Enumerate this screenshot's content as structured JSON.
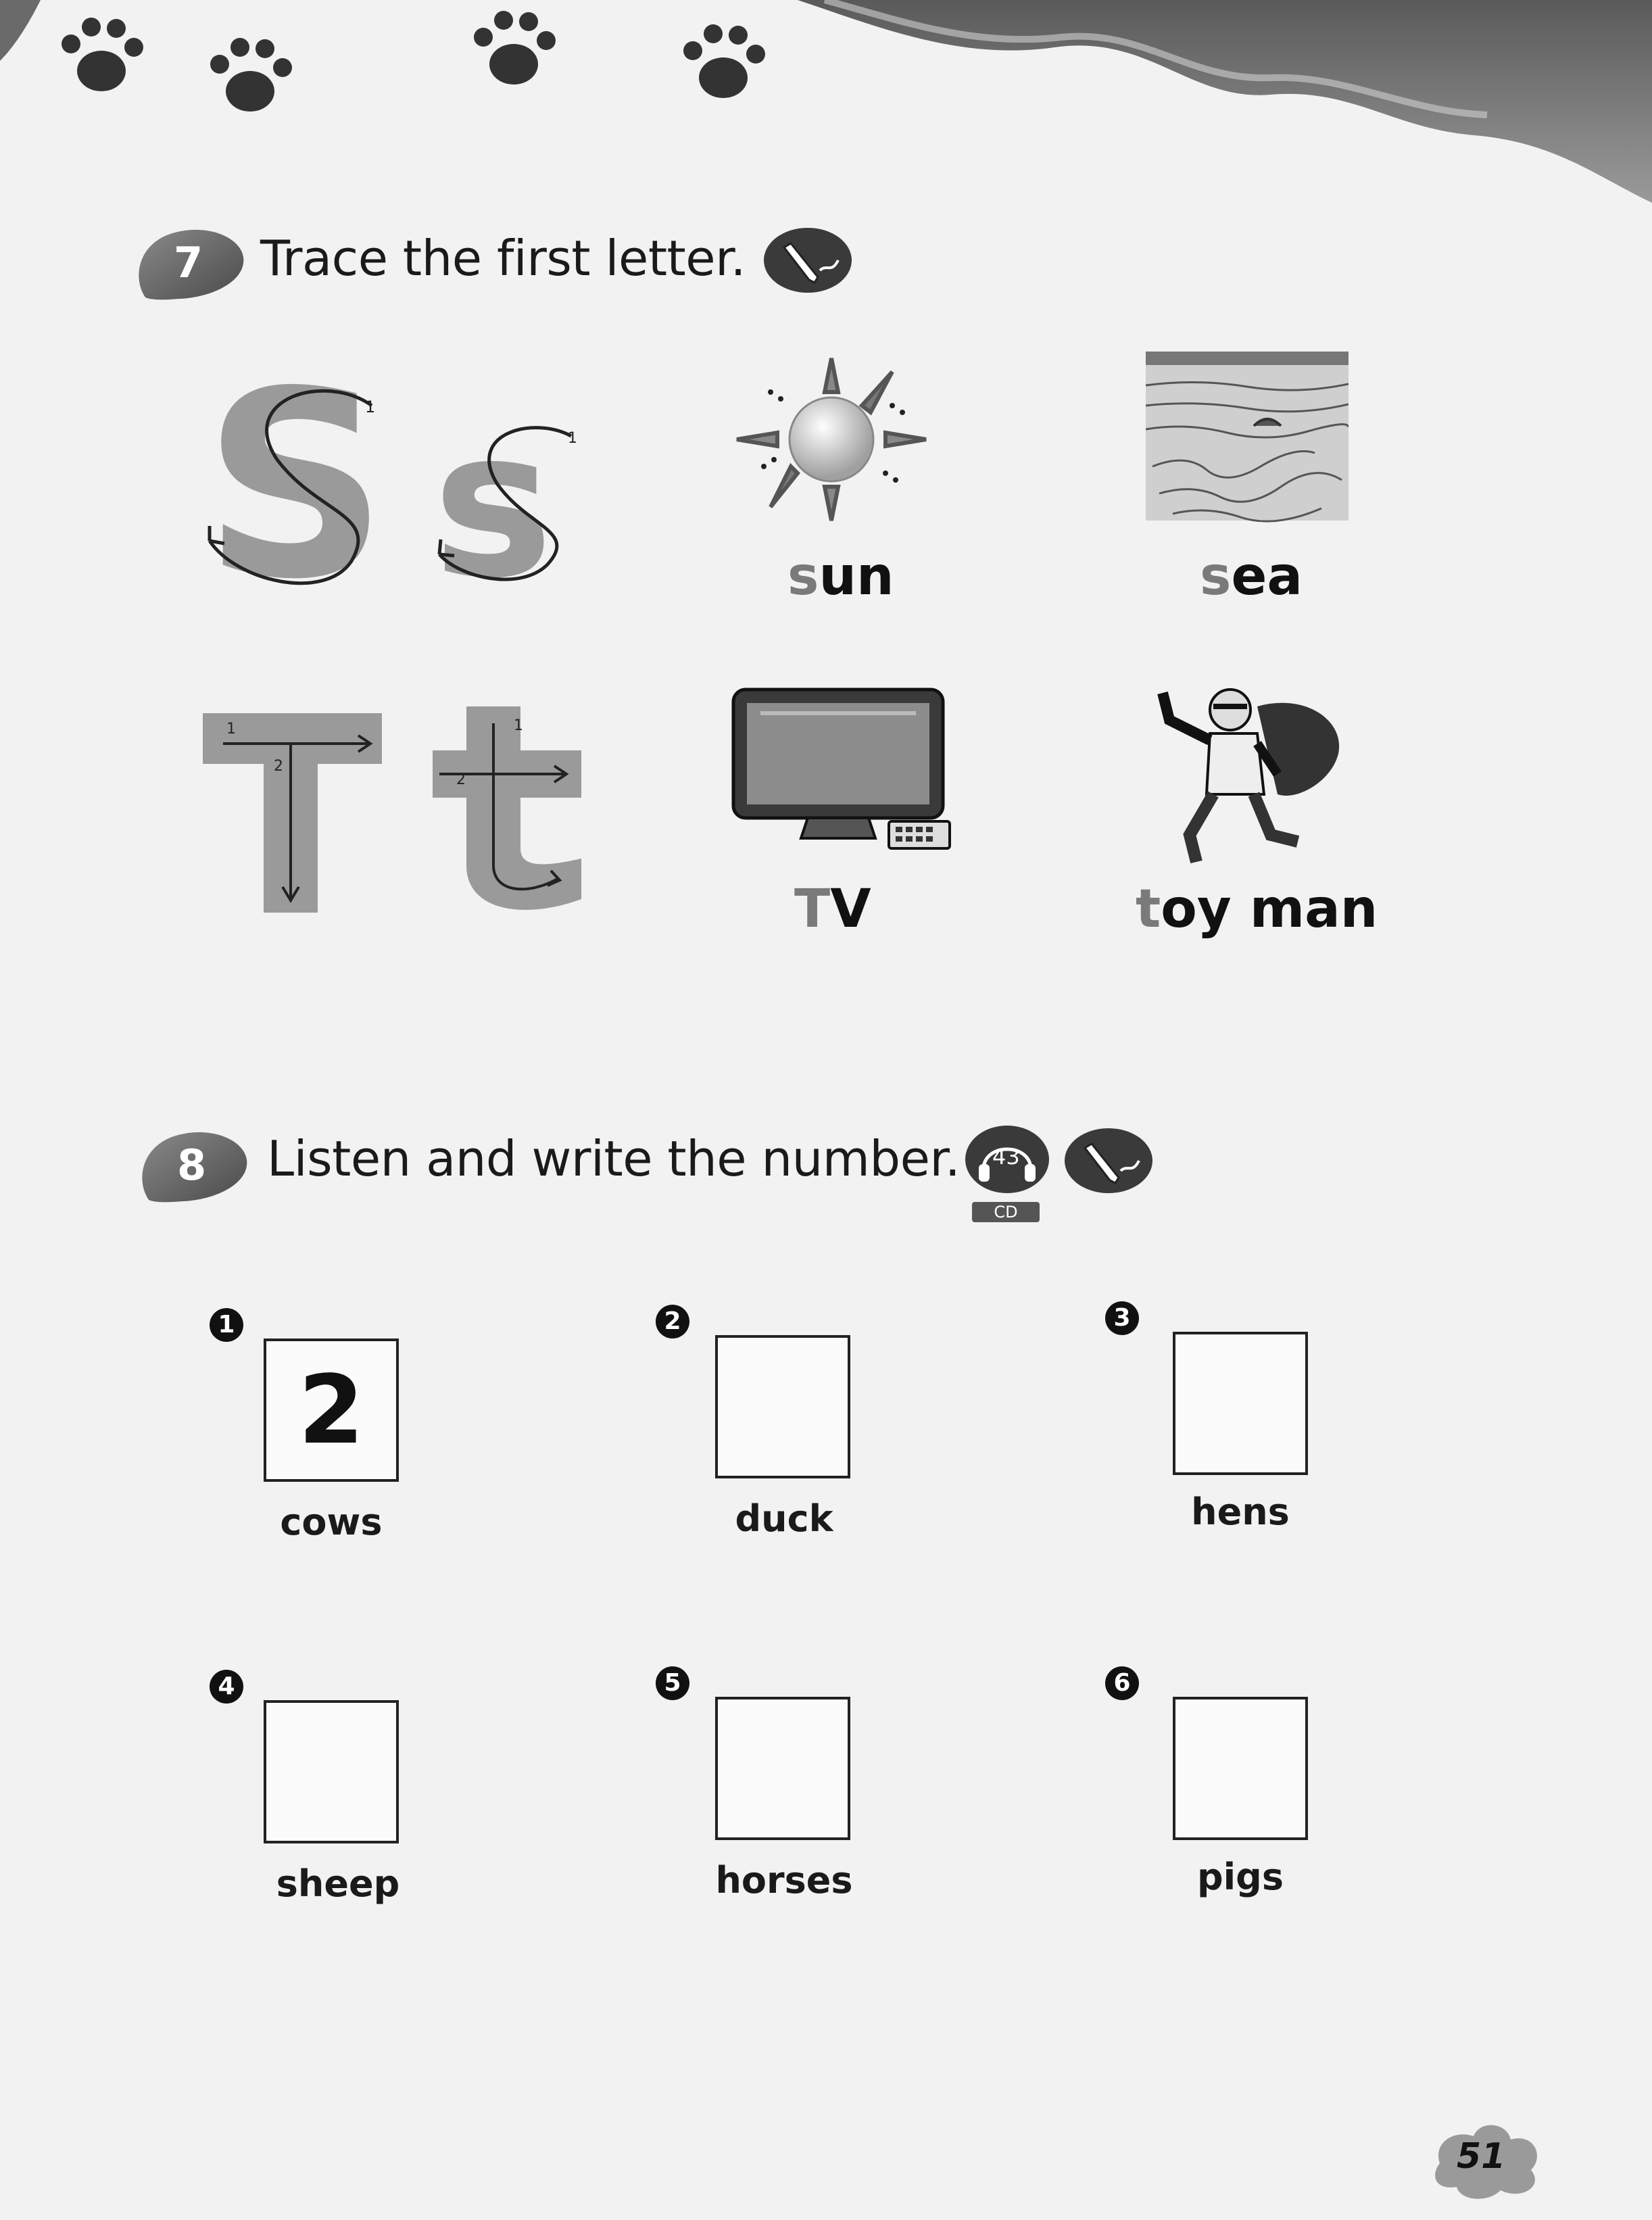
{
  "section7": {
    "number": "7",
    "title": "Trace the first letter.",
    "tool_icon": "pencil-icon",
    "letters": {
      "upper_s": "S",
      "lower_s": "s",
      "upper_t": "T",
      "lower_t": "t",
      "stroke_1": "1",
      "stroke_2": "2"
    },
    "words": [
      {
        "first": "s",
        "rest": "un"
      },
      {
        "first": "s",
        "rest": "ea"
      },
      {
        "first": "T",
        "rest": "V"
      },
      {
        "first": "t",
        "rest": "oy man"
      }
    ]
  },
  "section8": {
    "number": "8",
    "title": "Listen and write the number.",
    "track": "43",
    "cd_label": "CD",
    "items": [
      {
        "index": "1",
        "answer": "2",
        "label": "cows"
      },
      {
        "index": "2",
        "answer": "",
        "label": "duck"
      },
      {
        "index": "3",
        "answer": "",
        "label": "hens"
      },
      {
        "index": "4",
        "answer": "",
        "label": "sheep"
      },
      {
        "index": "5",
        "answer": "",
        "label": "horses"
      },
      {
        "index": "6",
        "answer": "",
        "label": "pigs"
      }
    ]
  },
  "page_number": "51",
  "colors": {
    "gray_letter": "#7a7a7a",
    "badge": "#6e6e6e"
  }
}
